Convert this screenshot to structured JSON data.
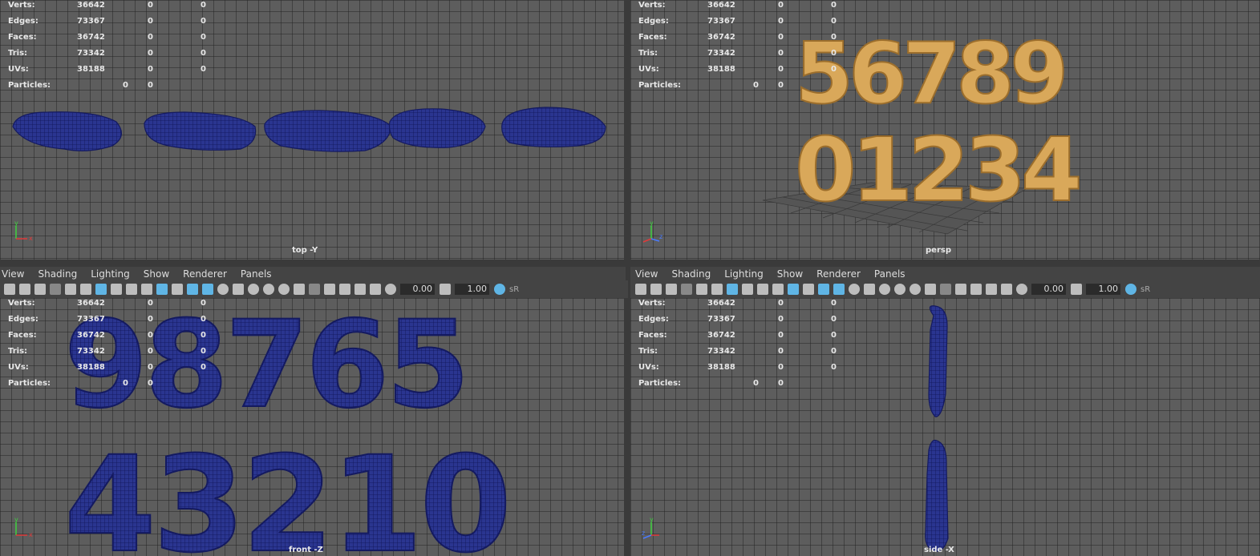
{
  "menus": [
    "View",
    "Shading",
    "Lighting",
    "Show",
    "Renderer",
    "Panels"
  ],
  "toolbar": {
    "value_a": "0.00",
    "value_b": "1.00",
    "extra": "sR"
  },
  "hud": {
    "top": [
      [
        "Verts:",
        "36642",
        "0",
        "0"
      ],
      [
        "Edges:",
        "73367",
        "0",
        "0"
      ],
      [
        "Faces:",
        "36742",
        "0",
        "0"
      ],
      [
        "Tris:",
        "73342",
        "0",
        "0"
      ],
      [
        "UVs:",
        "38188",
        "0",
        "0"
      ],
      [
        "Particles:",
        "0",
        "0",
        ""
      ]
    ],
    "persp": [
      [
        "Verts:",
        "36642",
        "0",
        "0"
      ],
      [
        "Edges:",
        "73367",
        "0",
        "0"
      ],
      [
        "Faces:",
        "36742",
        "0",
        "0"
      ],
      [
        "Tris:",
        "73342",
        "0",
        "0"
      ],
      [
        "UVs:",
        "38188",
        "0",
        "0"
      ],
      [
        "Particles:",
        "0",
        "0",
        ""
      ]
    ],
    "front": [
      [
        "Verts:",
        "36642",
        "0",
        "0"
      ],
      [
        "Edges:",
        "73367",
        "0",
        "0"
      ],
      [
        "Faces:",
        "36742",
        "0",
        "0"
      ],
      [
        "Tris:",
        "73342",
        "0",
        "0"
      ],
      [
        "UVs:",
        "38188",
        "0",
        "0"
      ],
      [
        "Particles:",
        "0",
        "0",
        ""
      ]
    ],
    "side": [
      [
        "Verts:",
        "36642",
        "0",
        "0"
      ],
      [
        "Edges:",
        "73367",
        "0",
        "0"
      ],
      [
        "Faces:",
        "36742",
        "0",
        "0"
      ],
      [
        "Tris:",
        "73342",
        "0",
        "0"
      ],
      [
        "UVs:",
        "38188",
        "0",
        "0"
      ],
      [
        "Particles:",
        "0",
        "0",
        ""
      ]
    ]
  },
  "cameras": {
    "top": "top -Y",
    "persp": "persp",
    "front": "front -Z",
    "side": "side -X"
  },
  "persp_digits": {
    "row1": "56789",
    "row2": "01234"
  },
  "front_digits": {
    "row1": "98765",
    "row2": "43210"
  },
  "axis_labels": {
    "x": "x",
    "y": "y",
    "z": "z"
  },
  "colors": {
    "viewport": "#5d5d5d",
    "wire": "#1a237e",
    "gold": "#d9a85a",
    "accent": "#5fb5e5"
  }
}
